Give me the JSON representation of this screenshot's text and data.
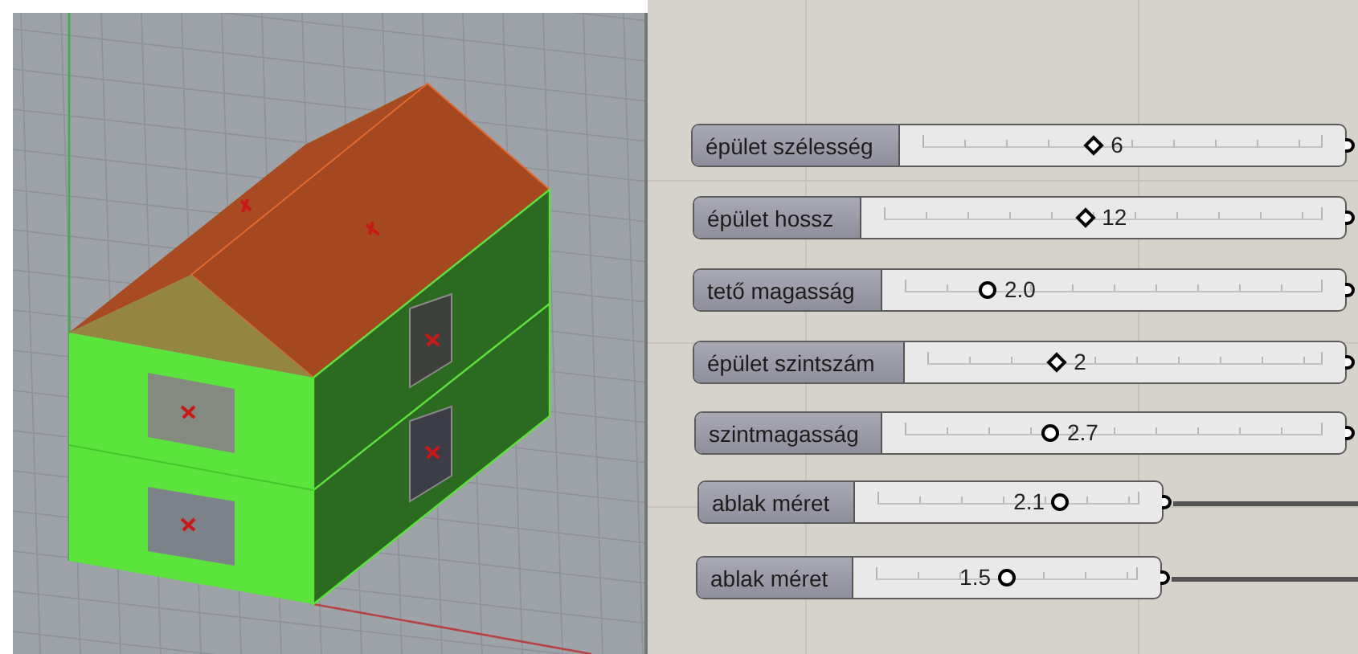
{
  "sliders": [
    {
      "label": "épület szélesség",
      "kind": "integer",
      "level": 0.43,
      "value": "6",
      "wired": false
    },
    {
      "label": "épület hossz",
      "kind": "integer",
      "level": 0.46,
      "value": "12",
      "wired": false
    },
    {
      "label": "tető magasság",
      "kind": "float",
      "level": 0.2,
      "value": "2.0",
      "wired": false
    },
    {
      "label": "épület szintszám",
      "kind": "integer",
      "level": 0.33,
      "value": "2",
      "wired": false
    },
    {
      "label": "szintmagasság",
      "kind": "float",
      "level": 0.35,
      "value": "2.7",
      "wired": false
    },
    {
      "label": "ablak méret",
      "kind": "float",
      "level": 0.7,
      "value": "2.1",
      "wired": true
    },
    {
      "label": "ablak méret",
      "kind": "float",
      "level": 0.5,
      "value": "1.5",
      "wired": true
    }
  ]
}
